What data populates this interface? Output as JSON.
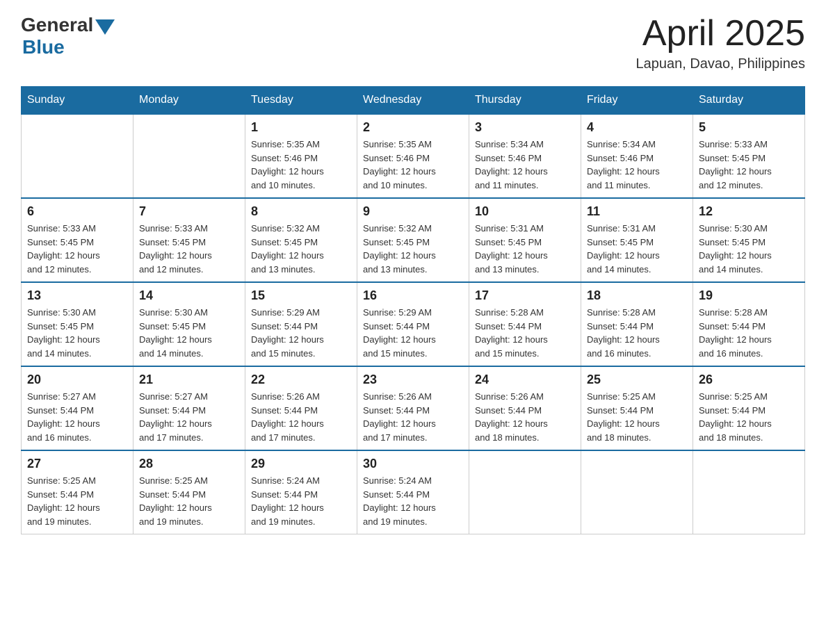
{
  "header": {
    "logo_general": "General",
    "logo_blue": "Blue",
    "month_title": "April 2025",
    "location": "Lapuan, Davao, Philippines"
  },
  "weekdays": [
    "Sunday",
    "Monday",
    "Tuesday",
    "Wednesday",
    "Thursday",
    "Friday",
    "Saturday"
  ],
  "weeks": [
    [
      {
        "day": "",
        "info": ""
      },
      {
        "day": "",
        "info": ""
      },
      {
        "day": "1",
        "info": "Sunrise: 5:35 AM\nSunset: 5:46 PM\nDaylight: 12 hours\nand 10 minutes."
      },
      {
        "day": "2",
        "info": "Sunrise: 5:35 AM\nSunset: 5:46 PM\nDaylight: 12 hours\nand 10 minutes."
      },
      {
        "day": "3",
        "info": "Sunrise: 5:34 AM\nSunset: 5:46 PM\nDaylight: 12 hours\nand 11 minutes."
      },
      {
        "day": "4",
        "info": "Sunrise: 5:34 AM\nSunset: 5:46 PM\nDaylight: 12 hours\nand 11 minutes."
      },
      {
        "day": "5",
        "info": "Sunrise: 5:33 AM\nSunset: 5:45 PM\nDaylight: 12 hours\nand 12 minutes."
      }
    ],
    [
      {
        "day": "6",
        "info": "Sunrise: 5:33 AM\nSunset: 5:45 PM\nDaylight: 12 hours\nand 12 minutes."
      },
      {
        "day": "7",
        "info": "Sunrise: 5:33 AM\nSunset: 5:45 PM\nDaylight: 12 hours\nand 12 minutes."
      },
      {
        "day": "8",
        "info": "Sunrise: 5:32 AM\nSunset: 5:45 PM\nDaylight: 12 hours\nand 13 minutes."
      },
      {
        "day": "9",
        "info": "Sunrise: 5:32 AM\nSunset: 5:45 PM\nDaylight: 12 hours\nand 13 minutes."
      },
      {
        "day": "10",
        "info": "Sunrise: 5:31 AM\nSunset: 5:45 PM\nDaylight: 12 hours\nand 13 minutes."
      },
      {
        "day": "11",
        "info": "Sunrise: 5:31 AM\nSunset: 5:45 PM\nDaylight: 12 hours\nand 14 minutes."
      },
      {
        "day": "12",
        "info": "Sunrise: 5:30 AM\nSunset: 5:45 PM\nDaylight: 12 hours\nand 14 minutes."
      }
    ],
    [
      {
        "day": "13",
        "info": "Sunrise: 5:30 AM\nSunset: 5:45 PM\nDaylight: 12 hours\nand 14 minutes."
      },
      {
        "day": "14",
        "info": "Sunrise: 5:30 AM\nSunset: 5:45 PM\nDaylight: 12 hours\nand 14 minutes."
      },
      {
        "day": "15",
        "info": "Sunrise: 5:29 AM\nSunset: 5:44 PM\nDaylight: 12 hours\nand 15 minutes."
      },
      {
        "day": "16",
        "info": "Sunrise: 5:29 AM\nSunset: 5:44 PM\nDaylight: 12 hours\nand 15 minutes."
      },
      {
        "day": "17",
        "info": "Sunrise: 5:28 AM\nSunset: 5:44 PM\nDaylight: 12 hours\nand 15 minutes."
      },
      {
        "day": "18",
        "info": "Sunrise: 5:28 AM\nSunset: 5:44 PM\nDaylight: 12 hours\nand 16 minutes."
      },
      {
        "day": "19",
        "info": "Sunrise: 5:28 AM\nSunset: 5:44 PM\nDaylight: 12 hours\nand 16 minutes."
      }
    ],
    [
      {
        "day": "20",
        "info": "Sunrise: 5:27 AM\nSunset: 5:44 PM\nDaylight: 12 hours\nand 16 minutes."
      },
      {
        "day": "21",
        "info": "Sunrise: 5:27 AM\nSunset: 5:44 PM\nDaylight: 12 hours\nand 17 minutes."
      },
      {
        "day": "22",
        "info": "Sunrise: 5:26 AM\nSunset: 5:44 PM\nDaylight: 12 hours\nand 17 minutes."
      },
      {
        "day": "23",
        "info": "Sunrise: 5:26 AM\nSunset: 5:44 PM\nDaylight: 12 hours\nand 17 minutes."
      },
      {
        "day": "24",
        "info": "Sunrise: 5:26 AM\nSunset: 5:44 PM\nDaylight: 12 hours\nand 18 minutes."
      },
      {
        "day": "25",
        "info": "Sunrise: 5:25 AM\nSunset: 5:44 PM\nDaylight: 12 hours\nand 18 minutes."
      },
      {
        "day": "26",
        "info": "Sunrise: 5:25 AM\nSunset: 5:44 PM\nDaylight: 12 hours\nand 18 minutes."
      }
    ],
    [
      {
        "day": "27",
        "info": "Sunrise: 5:25 AM\nSunset: 5:44 PM\nDaylight: 12 hours\nand 19 minutes."
      },
      {
        "day": "28",
        "info": "Sunrise: 5:25 AM\nSunset: 5:44 PM\nDaylight: 12 hours\nand 19 minutes."
      },
      {
        "day": "29",
        "info": "Sunrise: 5:24 AM\nSunset: 5:44 PM\nDaylight: 12 hours\nand 19 minutes."
      },
      {
        "day": "30",
        "info": "Sunrise: 5:24 AM\nSunset: 5:44 PM\nDaylight: 12 hours\nand 19 minutes."
      },
      {
        "day": "",
        "info": ""
      },
      {
        "day": "",
        "info": ""
      },
      {
        "day": "",
        "info": ""
      }
    ]
  ]
}
